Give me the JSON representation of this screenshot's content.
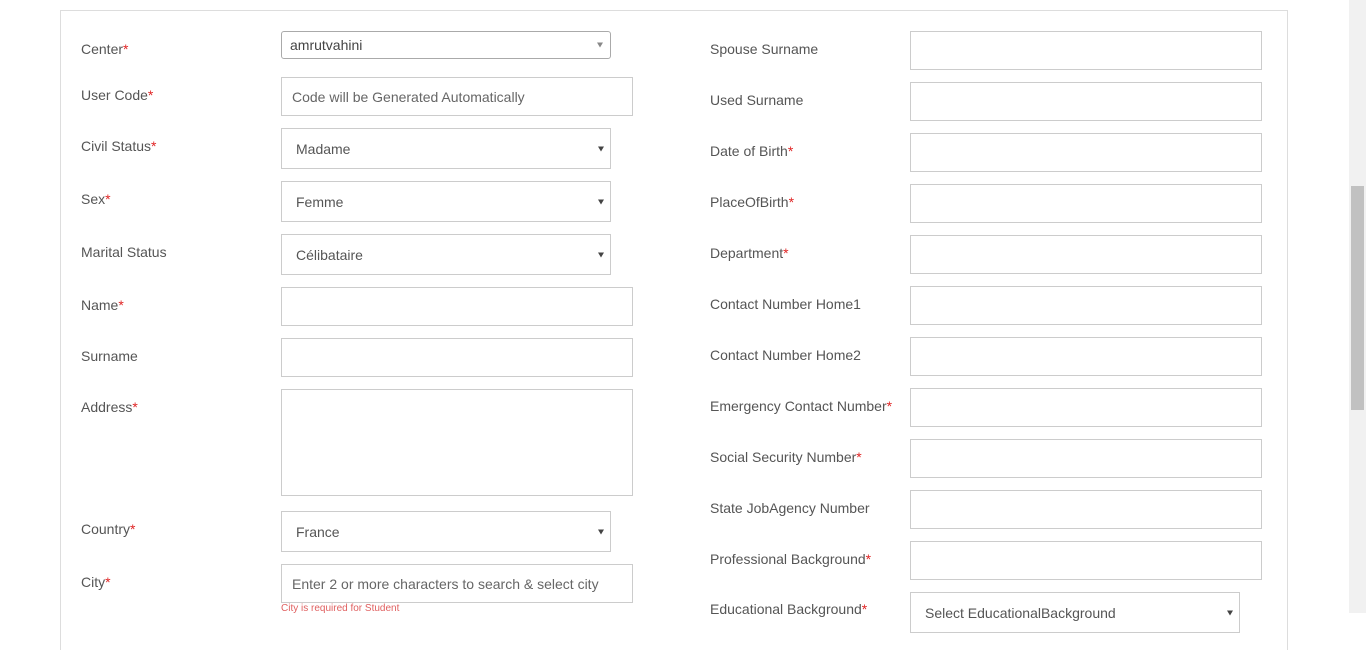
{
  "left": [
    {
      "key": "center",
      "label": "Center",
      "required": true,
      "type": "select2",
      "value": "amrutvahini"
    },
    {
      "key": "user_code",
      "label": "User Code",
      "required": true,
      "type": "input",
      "placeholder": "Code will be Generated Automatically"
    },
    {
      "key": "civil_status",
      "label": "Civil Status",
      "required": true,
      "type": "select",
      "value": "Madame"
    },
    {
      "key": "sex",
      "label": "Sex",
      "required": true,
      "type": "select",
      "value": "Femme"
    },
    {
      "key": "marital_status",
      "label": "Marital Status",
      "required": false,
      "type": "select",
      "value": "Célibataire"
    },
    {
      "key": "name",
      "label": "Name",
      "required": true,
      "type": "input",
      "placeholder": ""
    },
    {
      "key": "surname",
      "label": "Surname",
      "required": false,
      "type": "input",
      "placeholder": ""
    },
    {
      "key": "address",
      "label": "Address",
      "required": true,
      "type": "textarea",
      "placeholder": ""
    },
    {
      "key": "country",
      "label": "Country",
      "required": true,
      "type": "select",
      "value": "France"
    },
    {
      "key": "city",
      "label": "City",
      "required": true,
      "type": "input",
      "placeholder": "Enter 2 or more characters to search & select city",
      "error": "City is required for Student"
    }
  ],
  "right": [
    {
      "key": "spouse_surname",
      "label": "Spouse Surname",
      "required": false,
      "type": "input"
    },
    {
      "key": "used_surname",
      "label": "Used Surname",
      "required": false,
      "type": "input"
    },
    {
      "key": "date_of_birth",
      "label": "Date of Birth",
      "required": true,
      "type": "input"
    },
    {
      "key": "place_of_birth",
      "label": "PlaceOfBirth",
      "required": true,
      "type": "input"
    },
    {
      "key": "department",
      "label": "Department",
      "required": true,
      "type": "input"
    },
    {
      "key": "contact_home1",
      "label": "Contact Number Home1",
      "required": false,
      "type": "input"
    },
    {
      "key": "contact_home2",
      "label": "Contact Number Home2",
      "required": false,
      "type": "input"
    },
    {
      "key": "emergency_contact",
      "label": "Emergency Contact Number",
      "required": true,
      "type": "input"
    },
    {
      "key": "social_security",
      "label": "Social Security Number",
      "required": true,
      "type": "input"
    },
    {
      "key": "state_job_agency",
      "label": "State JobAgency Number",
      "required": false,
      "type": "input"
    },
    {
      "key": "professional_background",
      "label": "Professional Background",
      "required": true,
      "type": "input"
    },
    {
      "key": "educational_background",
      "label": "Educational Background",
      "required": true,
      "type": "select",
      "value": "Select EducationalBackground"
    }
  ],
  "required_marker": "*"
}
